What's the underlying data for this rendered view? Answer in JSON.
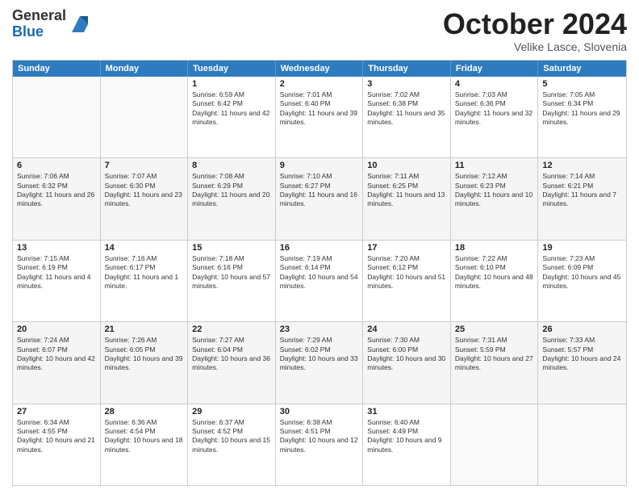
{
  "header": {
    "logo_general": "General",
    "logo_blue": "Blue",
    "month_title": "October 2024",
    "location": "Velike Lasce, Slovenia"
  },
  "weekdays": [
    "Sunday",
    "Monday",
    "Tuesday",
    "Wednesday",
    "Thursday",
    "Friday",
    "Saturday"
  ],
  "rows": [
    [
      {
        "day": "",
        "sunrise": "",
        "sunset": "",
        "daylight": ""
      },
      {
        "day": "",
        "sunrise": "",
        "sunset": "",
        "daylight": ""
      },
      {
        "day": "1",
        "sunrise": "Sunrise: 6:59 AM",
        "sunset": "Sunset: 6:42 PM",
        "daylight": "Daylight: 11 hours and 42 minutes."
      },
      {
        "day": "2",
        "sunrise": "Sunrise: 7:01 AM",
        "sunset": "Sunset: 6:40 PM",
        "daylight": "Daylight: 11 hours and 39 minutes."
      },
      {
        "day": "3",
        "sunrise": "Sunrise: 7:02 AM",
        "sunset": "Sunset: 6:38 PM",
        "daylight": "Daylight: 11 hours and 35 minutes."
      },
      {
        "day": "4",
        "sunrise": "Sunrise: 7:03 AM",
        "sunset": "Sunset: 6:36 PM",
        "daylight": "Daylight: 11 hours and 32 minutes."
      },
      {
        "day": "5",
        "sunrise": "Sunrise: 7:05 AM",
        "sunset": "Sunset: 6:34 PM",
        "daylight": "Daylight: 11 hours and 29 minutes."
      }
    ],
    [
      {
        "day": "6",
        "sunrise": "Sunrise: 7:06 AM",
        "sunset": "Sunset: 6:32 PM",
        "daylight": "Daylight: 11 hours and 26 minutes."
      },
      {
        "day": "7",
        "sunrise": "Sunrise: 7:07 AM",
        "sunset": "Sunset: 6:30 PM",
        "daylight": "Daylight: 11 hours and 23 minutes."
      },
      {
        "day": "8",
        "sunrise": "Sunrise: 7:08 AM",
        "sunset": "Sunset: 6:29 PM",
        "daylight": "Daylight: 11 hours and 20 minutes."
      },
      {
        "day": "9",
        "sunrise": "Sunrise: 7:10 AM",
        "sunset": "Sunset: 6:27 PM",
        "daylight": "Daylight: 11 hours and 16 minutes."
      },
      {
        "day": "10",
        "sunrise": "Sunrise: 7:11 AM",
        "sunset": "Sunset: 6:25 PM",
        "daylight": "Daylight: 11 hours and 13 minutes."
      },
      {
        "day": "11",
        "sunrise": "Sunrise: 7:12 AM",
        "sunset": "Sunset: 6:23 PM",
        "daylight": "Daylight: 11 hours and 10 minutes."
      },
      {
        "day": "12",
        "sunrise": "Sunrise: 7:14 AM",
        "sunset": "Sunset: 6:21 PM",
        "daylight": "Daylight: 11 hours and 7 minutes."
      }
    ],
    [
      {
        "day": "13",
        "sunrise": "Sunrise: 7:15 AM",
        "sunset": "Sunset: 6:19 PM",
        "daylight": "Daylight: 11 hours and 4 minutes."
      },
      {
        "day": "14",
        "sunrise": "Sunrise: 7:16 AM",
        "sunset": "Sunset: 6:17 PM",
        "daylight": "Daylight: 11 hours and 1 minute."
      },
      {
        "day": "15",
        "sunrise": "Sunrise: 7:18 AM",
        "sunset": "Sunset: 6:16 PM",
        "daylight": "Daylight: 10 hours and 57 minutes."
      },
      {
        "day": "16",
        "sunrise": "Sunrise: 7:19 AM",
        "sunset": "Sunset: 6:14 PM",
        "daylight": "Daylight: 10 hours and 54 minutes."
      },
      {
        "day": "17",
        "sunrise": "Sunrise: 7:20 AM",
        "sunset": "Sunset: 6:12 PM",
        "daylight": "Daylight: 10 hours and 51 minutes."
      },
      {
        "day": "18",
        "sunrise": "Sunrise: 7:22 AM",
        "sunset": "Sunset: 6:10 PM",
        "daylight": "Daylight: 10 hours and 48 minutes."
      },
      {
        "day": "19",
        "sunrise": "Sunrise: 7:23 AM",
        "sunset": "Sunset: 6:09 PM",
        "daylight": "Daylight: 10 hours and 45 minutes."
      }
    ],
    [
      {
        "day": "20",
        "sunrise": "Sunrise: 7:24 AM",
        "sunset": "Sunset: 6:07 PM",
        "daylight": "Daylight: 10 hours and 42 minutes."
      },
      {
        "day": "21",
        "sunrise": "Sunrise: 7:26 AM",
        "sunset": "Sunset: 6:05 PM",
        "daylight": "Daylight: 10 hours and 39 minutes."
      },
      {
        "day": "22",
        "sunrise": "Sunrise: 7:27 AM",
        "sunset": "Sunset: 6:04 PM",
        "daylight": "Daylight: 10 hours and 36 minutes."
      },
      {
        "day": "23",
        "sunrise": "Sunrise: 7:29 AM",
        "sunset": "Sunset: 6:02 PM",
        "daylight": "Daylight: 10 hours and 33 minutes."
      },
      {
        "day": "24",
        "sunrise": "Sunrise: 7:30 AM",
        "sunset": "Sunset: 6:00 PM",
        "daylight": "Daylight: 10 hours and 30 minutes."
      },
      {
        "day": "25",
        "sunrise": "Sunrise: 7:31 AM",
        "sunset": "Sunset: 5:59 PM",
        "daylight": "Daylight: 10 hours and 27 minutes."
      },
      {
        "day": "26",
        "sunrise": "Sunrise: 7:33 AM",
        "sunset": "Sunset: 5:57 PM",
        "daylight": "Daylight: 10 hours and 24 minutes."
      }
    ],
    [
      {
        "day": "27",
        "sunrise": "Sunrise: 6:34 AM",
        "sunset": "Sunset: 4:55 PM",
        "daylight": "Daylight: 10 hours and 21 minutes."
      },
      {
        "day": "28",
        "sunrise": "Sunrise: 6:36 AM",
        "sunset": "Sunset: 4:54 PM",
        "daylight": "Daylight: 10 hours and 18 minutes."
      },
      {
        "day": "29",
        "sunrise": "Sunrise: 6:37 AM",
        "sunset": "Sunset: 4:52 PM",
        "daylight": "Daylight: 10 hours and 15 minutes."
      },
      {
        "day": "30",
        "sunrise": "Sunrise: 6:38 AM",
        "sunset": "Sunset: 4:51 PM",
        "daylight": "Daylight: 10 hours and 12 minutes."
      },
      {
        "day": "31",
        "sunrise": "Sunrise: 6:40 AM",
        "sunset": "Sunset: 4:49 PM",
        "daylight": "Daylight: 10 hours and 9 minutes."
      },
      {
        "day": "",
        "sunrise": "",
        "sunset": "",
        "daylight": ""
      },
      {
        "day": "",
        "sunrise": "",
        "sunset": "",
        "daylight": ""
      }
    ]
  ]
}
